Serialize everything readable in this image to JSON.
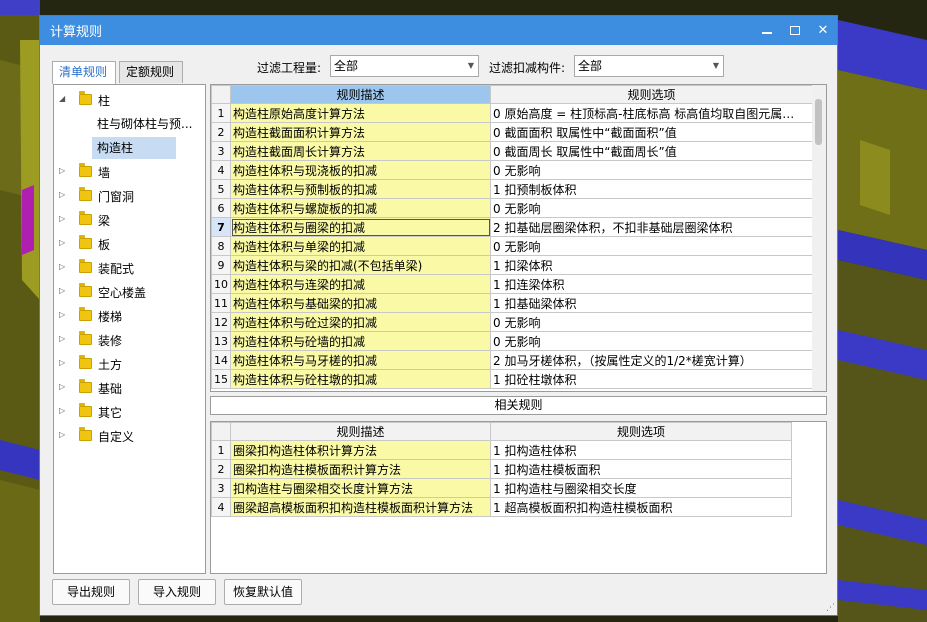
{
  "window": {
    "title": "计算规则",
    "min_icon": "minimize-icon",
    "max_icon": "maximize-icon",
    "close_icon": "close-icon",
    "close_glyph": "✕"
  },
  "filter": {
    "quantity_label": "过滤工程量:",
    "quantity_value": "全部",
    "component_label": "过滤扣减构件:",
    "component_value": "全部"
  },
  "tabs": [
    {
      "label": "清单规则",
      "active": true
    },
    {
      "label": "定额规则",
      "active": false
    }
  ],
  "tree": {
    "root": {
      "label": "柱",
      "expanded": true
    },
    "children": [
      {
        "label": "柱与砌体柱与预...",
        "selected": false
      },
      {
        "label": "构造柱",
        "selected": true
      }
    ],
    "nodes": [
      "墙",
      "门窗洞",
      "梁",
      "板",
      "装配式",
      "空心楼盖",
      "楼梯",
      "装修",
      "土方",
      "基础",
      "其它",
      "自定义"
    ]
  },
  "rules": {
    "headers": {
      "desc": "规则描述",
      "option": "规则选项"
    },
    "current_row": 7,
    "rows": [
      {
        "no": "1",
        "desc": "构造柱原始高度计算方法",
        "option": "0 原始高度 = 柱顶标高-柱底标高  标高值均取自图元属…"
      },
      {
        "no": "2",
        "desc": "构造柱截面面积计算方法",
        "option": "0 截面面积  取属性中“截面面积”值"
      },
      {
        "no": "3",
        "desc": "构造柱截面周长计算方法",
        "option": "0 截面周长  取属性中“截面周长”值"
      },
      {
        "no": "4",
        "desc": "构造柱体积与现浇板的扣减",
        "option": "0  无影响"
      },
      {
        "no": "5",
        "desc": "构造柱体积与预制板的扣减",
        "option": "1 扣预制板体积"
      },
      {
        "no": "6",
        "desc": "构造柱体积与螺旋板的扣减",
        "option": "0  无影响"
      },
      {
        "no": "7",
        "desc": "构造柱体积与圈梁的扣减",
        "option": "2 扣基础层圈梁体积，不扣非基础层圈梁体积"
      },
      {
        "no": "8",
        "desc": "构造柱体积与单梁的扣减",
        "option": "0  无影响"
      },
      {
        "no": "9",
        "desc": "构造柱体积与梁的扣减(不包括单梁)",
        "option": "1 扣梁体积"
      },
      {
        "no": "10",
        "desc": "构造柱体积与连梁的扣减",
        "option": "1 扣连梁体积"
      },
      {
        "no": "11",
        "desc": "构造柱体积与基础梁的扣减",
        "option": "1 扣基础梁体积"
      },
      {
        "no": "12",
        "desc": "构造柱体积与砼过梁的扣减",
        "option": "0  无影响"
      },
      {
        "no": "13",
        "desc": "构造柱体积与砼墙的扣减",
        "option": "0  无影响"
      },
      {
        "no": "14",
        "desc": "构造柱体积与马牙槎的扣减",
        "option": "2 加马牙槎体积，（按属性定义的1/2*槎宽计算）"
      },
      {
        "no": "15",
        "desc": "构造柱体积与砼柱墩的扣减",
        "option": "1 扣砼柱墩体积"
      }
    ]
  },
  "related": {
    "title": "相关规则",
    "headers": {
      "desc": "规则描述",
      "option": "规则选项"
    },
    "rows": [
      {
        "no": "1",
        "desc": "圈梁扣构造柱体积计算方法",
        "option": "1 扣构造柱体积"
      },
      {
        "no": "2",
        "desc": "圈梁扣构造柱模板面积计算方法",
        "option": "1 扣构造柱模板面积"
      },
      {
        "no": "3",
        "desc": "扣构造柱与圈梁相交长度计算方法",
        "option": "1 扣构造柱与圈梁相交长度"
      },
      {
        "no": "4",
        "desc": "圈梁超高模板面积扣构造柱模板面积计算方法",
        "option": "1 超高模板面积扣构造柱模板面积"
      }
    ]
  },
  "buttons": {
    "export": "导出规则",
    "import": "导入规则",
    "reset": "恢复默认值"
  },
  "colors": {
    "titlebar": "#3d8ee0",
    "desc_cell": "#fafaa6",
    "header_highlight": "#9cc6ee",
    "tree_selected": "#c7dcf2"
  }
}
